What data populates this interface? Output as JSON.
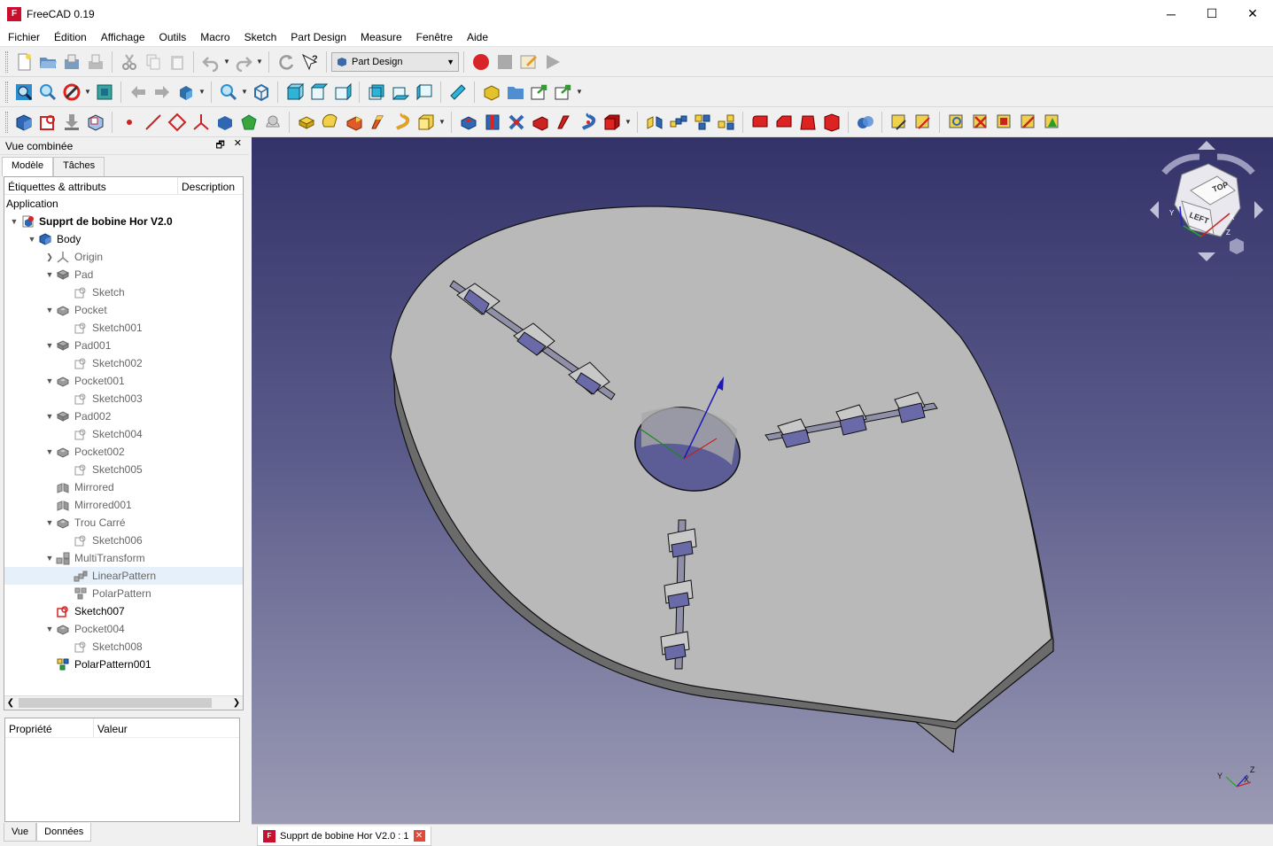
{
  "window": {
    "title": "FreeCAD 0.19",
    "logo_text": "F",
    "minimize": "─",
    "maximize": "☐",
    "close": "✕"
  },
  "menu": [
    "Fichier",
    "Édition",
    "Affichage",
    "Outils",
    "Macro",
    "Sketch",
    "Part Design",
    "Measure",
    "Fenêtre",
    "Aide"
  ],
  "workbench": {
    "selected": "Part Design"
  },
  "combo": {
    "title": "Vue combinée",
    "float_icon": "🗗",
    "close_icon": "✕",
    "tabs": [
      "Modèle",
      "Tâches"
    ],
    "tree_headers": [
      "Étiquettes & attributs",
      "Description"
    ],
    "root_label": "Application",
    "items": [
      {
        "label": "Supprt de bobine Hor V2.0",
        "style": "bold",
        "icon": "document-icon"
      },
      {
        "label": "Body",
        "style": "normal",
        "icon": "body-icon"
      },
      {
        "label": "Origin",
        "style": "grey",
        "icon": "origin-icon"
      },
      {
        "label": "Pad",
        "style": "grey",
        "icon": "pad-icon"
      },
      {
        "label": "Sketch",
        "style": "grey",
        "icon": "sketch-icon"
      },
      {
        "label": "Pocket",
        "style": "grey",
        "icon": "pocket-icon"
      },
      {
        "label": "Sketch001",
        "style": "grey",
        "icon": "sketch-icon"
      },
      {
        "label": "Pad001",
        "style": "grey",
        "icon": "pad-icon"
      },
      {
        "label": "Sketch002",
        "style": "grey",
        "icon": "sketch-icon"
      },
      {
        "label": "Pocket001",
        "style": "grey",
        "icon": "pocket-icon"
      },
      {
        "label": "Sketch003",
        "style": "grey",
        "icon": "sketch-icon"
      },
      {
        "label": "Pad002",
        "style": "grey",
        "icon": "pad-icon"
      },
      {
        "label": "Sketch004",
        "style": "grey",
        "icon": "sketch-icon"
      },
      {
        "label": "Pocket002",
        "style": "grey",
        "icon": "pocket-icon"
      },
      {
        "label": "Sketch005",
        "style": "grey",
        "icon": "sketch-icon"
      },
      {
        "label": "Mirrored",
        "style": "grey",
        "icon": "mirrored-icon"
      },
      {
        "label": "Mirrored001",
        "style": "grey",
        "icon": "mirrored-icon"
      },
      {
        "label": "Trou Carré",
        "style": "grey",
        "icon": "pocket-icon"
      },
      {
        "label": "Sketch006",
        "style": "grey",
        "icon": "sketch-icon"
      },
      {
        "label": "MultiTransform",
        "style": "grey",
        "icon": "multitransform-icon"
      },
      {
        "label": "LinearPattern",
        "style": "grey",
        "icon": "linearpattern-icon"
      },
      {
        "label": "PolarPattern",
        "style": "grey",
        "icon": "polarpattern-icon"
      },
      {
        "label": "Sketch007",
        "style": "normal",
        "icon": "sketch-active-icon"
      },
      {
        "label": "Pocket004",
        "style": "grey",
        "icon": "pocket-icon"
      },
      {
        "label": "Sketch008",
        "style": "grey",
        "icon": "sketch-icon"
      },
      {
        "label": "PolarPattern001",
        "style": "normal",
        "icon": "polarpattern-active-icon"
      }
    ],
    "property_headers": [
      "Propriété",
      "Valeur"
    ],
    "bottom_tabs": [
      "Vue",
      "Données"
    ]
  },
  "navcube": {
    "top_face": "TOP",
    "front_face": "LEFT",
    "axis_x": "X",
    "axis_y": "Y",
    "axis_z": "Z"
  },
  "axis_indicator": {
    "x": "X",
    "y": "Y",
    "z": "Z"
  },
  "document_tab": {
    "label": "Supprt de bobine Hor V2.0 : 1",
    "close": "✕"
  },
  "colors": {
    "view_top": "#33336a",
    "view_bottom": "#9b9bb5",
    "part_face": "#b9b9b9",
    "selection": "#e5f0fb",
    "record": "#d9252a"
  }
}
